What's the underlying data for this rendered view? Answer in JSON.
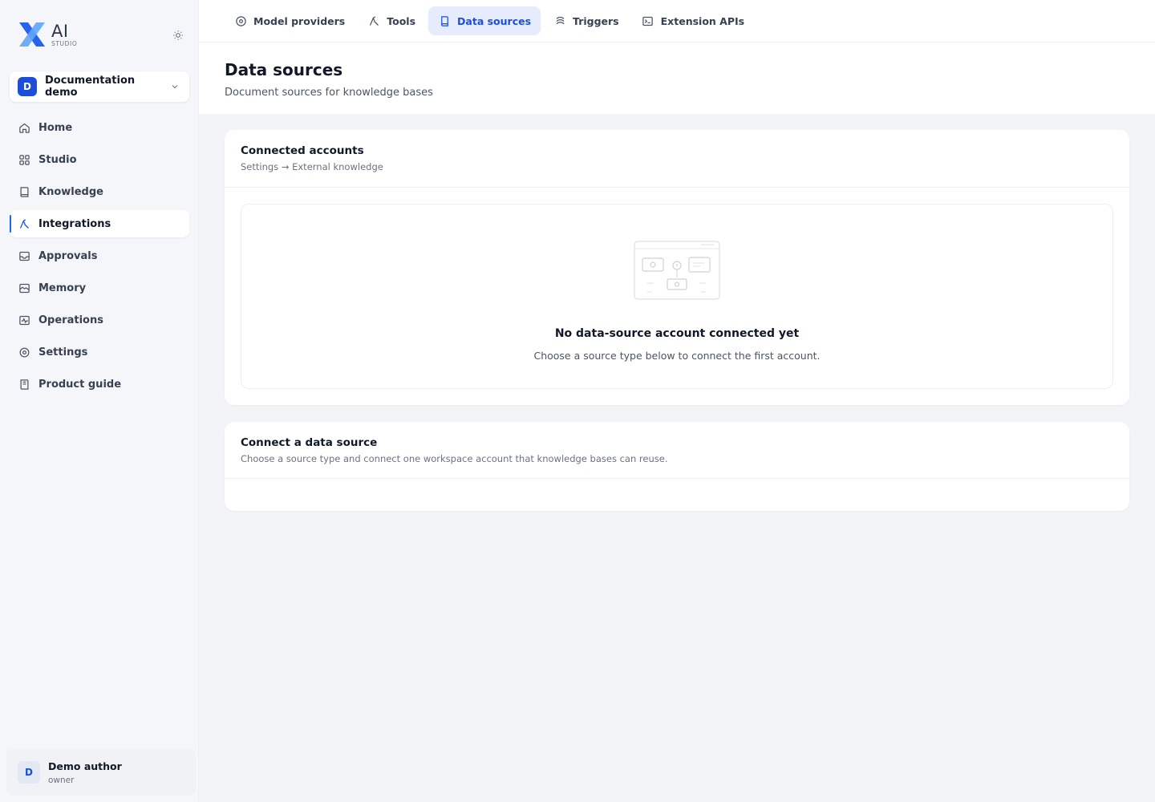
{
  "brand": {
    "name": "AI",
    "sub": "STUDIO",
    "accent": "#1d4ed8"
  },
  "workspace": {
    "initial": "D",
    "name": "Documentation demo"
  },
  "sidebar": {
    "items": [
      {
        "label": "Home",
        "icon": "home-icon"
      },
      {
        "label": "Studio",
        "icon": "grid-icon"
      },
      {
        "label": "Knowledge",
        "icon": "book-icon"
      },
      {
        "label": "Integrations",
        "icon": "integrations-icon",
        "active": true
      },
      {
        "label": "Approvals",
        "icon": "inbox-icon"
      },
      {
        "label": "Memory",
        "icon": "memory-icon"
      },
      {
        "label": "Operations",
        "icon": "activity-icon"
      },
      {
        "label": "Settings",
        "icon": "gear-icon"
      },
      {
        "label": "Product guide",
        "icon": "guide-book-icon"
      }
    ]
  },
  "user": {
    "initial": "D",
    "name": "Demo author",
    "role": "owner"
  },
  "tabs": [
    {
      "label": "Model providers",
      "icon": "provider-icon"
    },
    {
      "label": "Tools",
      "icon": "tools-icon"
    },
    {
      "label": "Data sources",
      "icon": "data-source-icon",
      "active": true
    },
    {
      "label": "Triggers",
      "icon": "triggers-icon"
    },
    {
      "label": "Extension APIs",
      "icon": "terminal-icon"
    }
  ],
  "page": {
    "title": "Data sources",
    "subtitle": "Document sources for knowledge bases"
  },
  "connected": {
    "title": "Connected accounts",
    "breadcrumb": "Settings → External knowledge",
    "empty_title": "No data-source account connected yet",
    "empty_sub": "Choose a source type below to connect the first account."
  },
  "connect": {
    "title": "Connect a data source",
    "subtitle": "Choose a source type and connect one workspace account that knowledge bases can reuse."
  }
}
